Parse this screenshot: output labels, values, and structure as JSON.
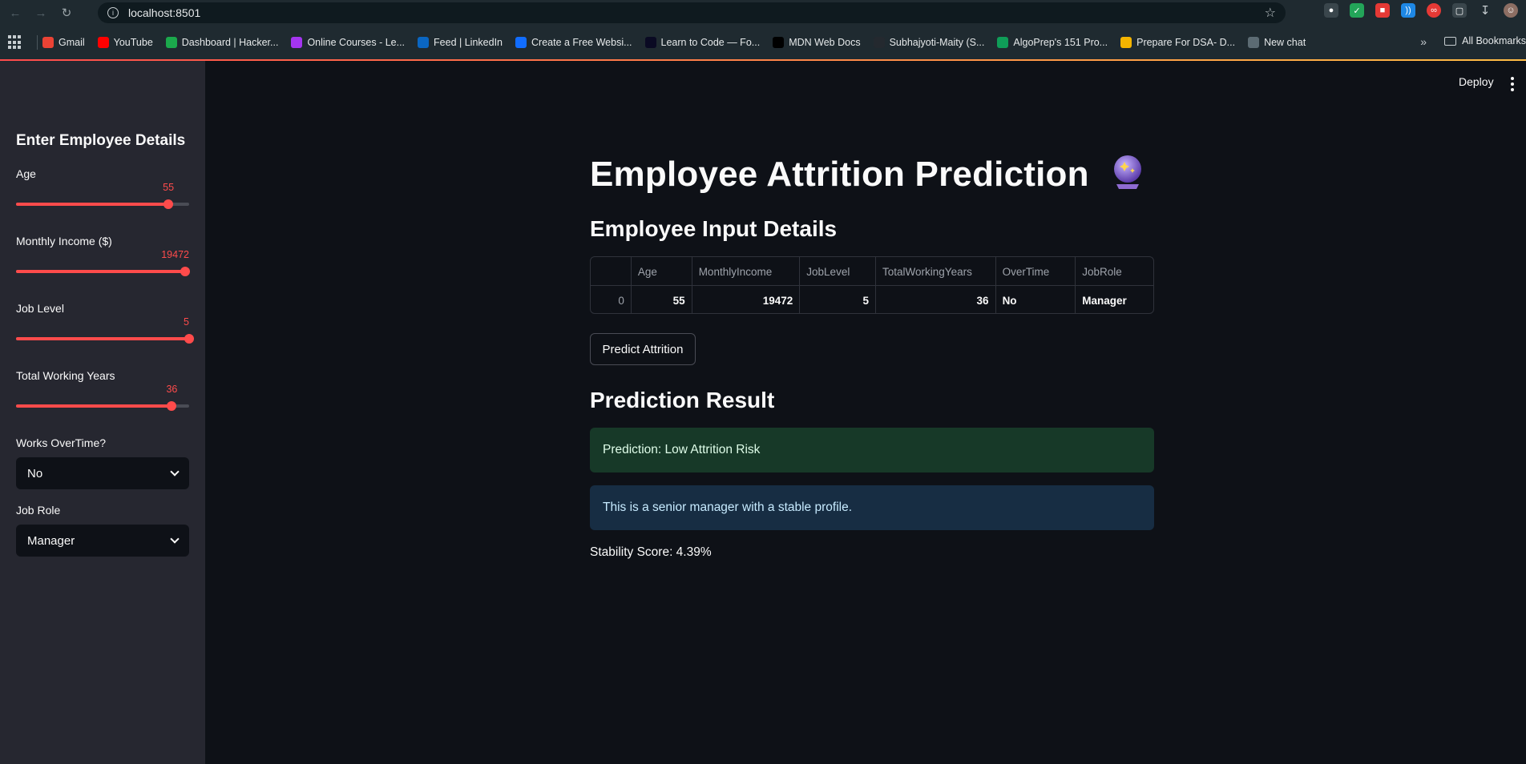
{
  "browser": {
    "url": "localhost:8501",
    "bookmarks": [
      {
        "label": "Gmail",
        "color": "#ea4335",
        "icon": "gmail-icon"
      },
      {
        "label": "YouTube",
        "color": "#ff0000",
        "icon": "youtube-icon"
      },
      {
        "label": "Dashboard | Hacker...",
        "color": "#1ba94c",
        "icon": "hackerrank-icon"
      },
      {
        "label": "Online Courses - Le...",
        "color": "#a435f0",
        "icon": "udemy-icon"
      },
      {
        "label": "Feed | LinkedIn",
        "color": "#0a66c2",
        "icon": "linkedin-icon"
      },
      {
        "label": "Create a Free Websi...",
        "color": "#116dff",
        "icon": "wix-icon"
      },
      {
        "label": "Learn to Code — Fo...",
        "color": "#0a0a23",
        "icon": "freecodecamp-icon"
      },
      {
        "label": "MDN Web Docs",
        "color": "#000000",
        "icon": "mdn-icon"
      },
      {
        "label": "Subhajyoti-Maity (S...",
        "color": "#24292f",
        "icon": "github-icon"
      },
      {
        "label": "AlgoPrep's 151 Pro...",
        "color": "#0f9d58",
        "icon": "sheets-icon"
      },
      {
        "label": "Prepare For DSA- D...",
        "color": "#f4b400",
        "icon": "loading-icon"
      },
      {
        "label": "New chat",
        "color": "#5c6b73",
        "icon": "chatgpt-icon"
      }
    ],
    "all_bookmarks": "All Bookmarks"
  },
  "sidebar": {
    "title": "Enter Employee Details",
    "sliders": [
      {
        "label": "Age",
        "value": "55",
        "fraction": 0.88
      },
      {
        "label": "Monthly Income ($)",
        "value": "19472",
        "fraction": 0.975
      },
      {
        "label": "Job Level",
        "value": "5",
        "fraction": 1.0
      },
      {
        "label": "Total Working Years",
        "value": "36",
        "fraction": 0.9
      }
    ],
    "overtime": {
      "label": "Works OverTime?",
      "value": "No"
    },
    "job_role": {
      "label": "Job Role",
      "value": "Manager"
    }
  },
  "header": {
    "deploy": "Deploy"
  },
  "main": {
    "title": "Employee Attrition Prediction",
    "input_heading": "Employee Input Details",
    "table": {
      "columns": [
        "",
        "Age",
        "MonthlyIncome",
        "JobLevel",
        "TotalWorkingYears",
        "OverTime",
        "JobRole"
      ],
      "rows": [
        [
          "0",
          "55",
          "19472",
          "5",
          "36",
          "No",
          "Manager"
        ]
      ]
    },
    "predict_button": "Predict Attrition",
    "result_heading": "Prediction Result",
    "success_msg": "Prediction: Low Attrition Risk",
    "info_msg": "This is a senior manager with a stable profile.",
    "score": "Stability Score: 4.39%"
  },
  "colors": {
    "accent": "#ff4b4b",
    "success_bg": "#173928",
    "info_bg": "#172d43"
  }
}
